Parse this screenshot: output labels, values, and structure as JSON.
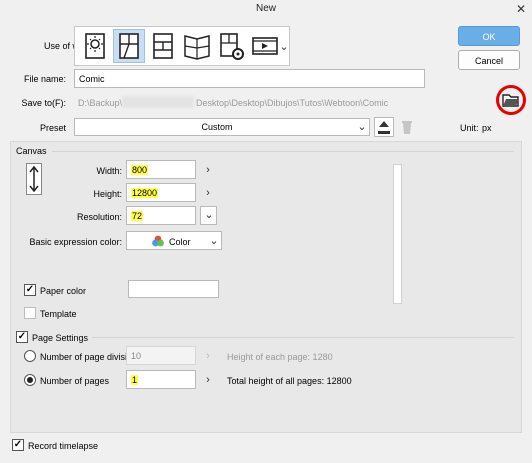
{
  "window": {
    "title": "New"
  },
  "buttons": {
    "ok": "OK",
    "cancel": "Cancel"
  },
  "use_of_work": {
    "label": "Use of work:",
    "icons": [
      "illustration-icon",
      "comic-icon",
      "page-layout-icon",
      "book-icon",
      "settings-page-icon",
      "animation-icon"
    ],
    "selected_index": 1
  },
  "file_name": {
    "label": "File name:",
    "value": "Comic"
  },
  "save_to": {
    "label": "Save to(F):",
    "path_start": "D:\\Backup\\",
    "path_end": "Desktop\\Desktop\\Dibujos\\Tutos\\Webtoon\\Comic",
    "highlight_color": "#e60000"
  },
  "preset": {
    "label": "Preset",
    "value": "Custom",
    "unit_label": "Unit:",
    "unit_value": "px"
  },
  "canvas": {
    "section": "Canvas",
    "width_label": "Width:",
    "width_value": "800",
    "height_label": "Height:",
    "height_value": "12800",
    "resolution_label": "Resolution:",
    "resolution_value": "72",
    "color_label": "Basic expression color:",
    "color_value": "Color",
    "paper_color_label": "Paper color",
    "template_label": "Template"
  },
  "page_settings": {
    "label": "Page Settings",
    "divisions_label": "Number of page divisions",
    "divisions_value": "10",
    "height_each_label": "Height of each page: 1280",
    "pages_label": "Number of pages",
    "pages_value": "1",
    "total_label": "Total height of all pages: 12800"
  },
  "record_timelapse": {
    "label": "Record timelapse"
  },
  "colors": {
    "accent": "#6aaee8",
    "highlight": "#ffff4a"
  }
}
